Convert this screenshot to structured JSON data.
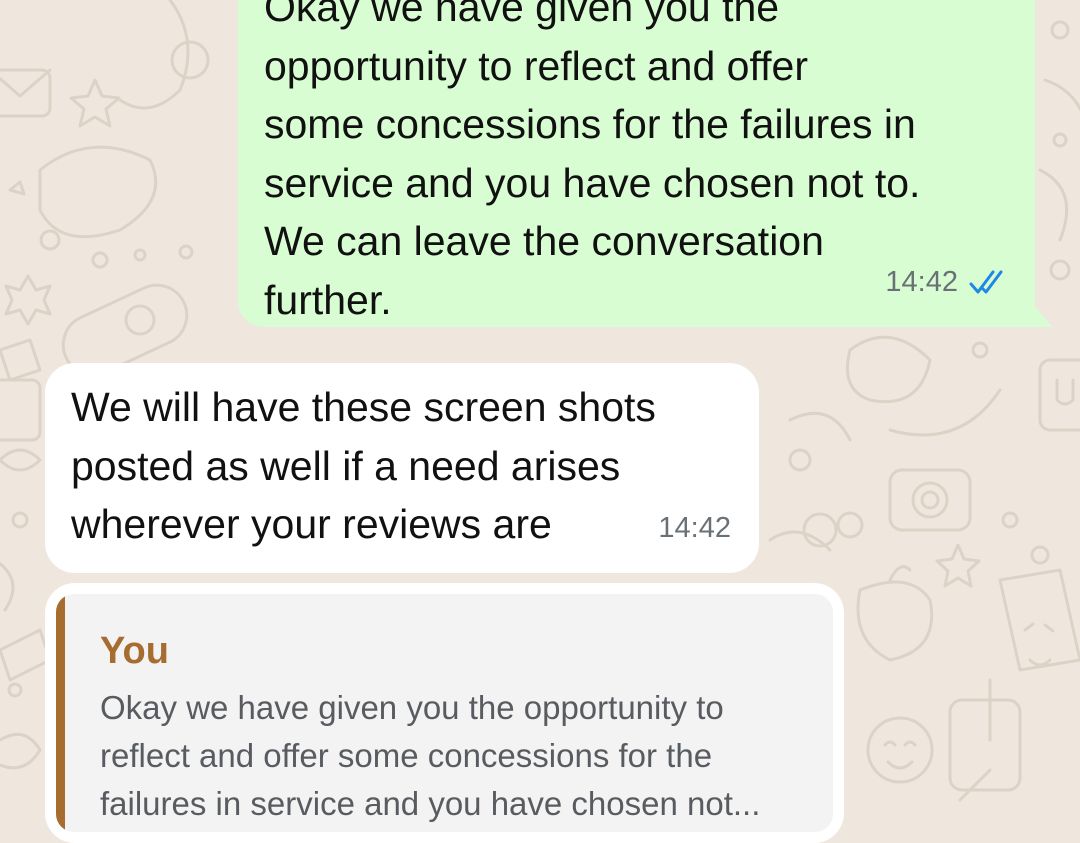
{
  "chat": {
    "outgoing": {
      "text": "Okay we have given you the\nopportunity to reflect and offer\nsome concessions for the failures in\nservice and you have chosen not to.\nWe can leave the conversation\nfurther.",
      "time": "14:42",
      "status": "read",
      "tick_color": "#1e88e5"
    },
    "incoming": {
      "text": "We will have these screen shots\nposted as well if a need arises\nwherever your reviews are",
      "time": "14:42"
    },
    "reply": {
      "quoted_author": "You",
      "quoted_text": "Okay we have given you the opportunity to\nreflect and offer some concessions for the\nfailures in service and you have chosen not..."
    }
  },
  "colors": {
    "wallpaper": "#efe7de",
    "outgoing_bubble": "#d9fdd3",
    "incoming_bubble": "#ffffff",
    "quote_accent": "#a66c30"
  }
}
